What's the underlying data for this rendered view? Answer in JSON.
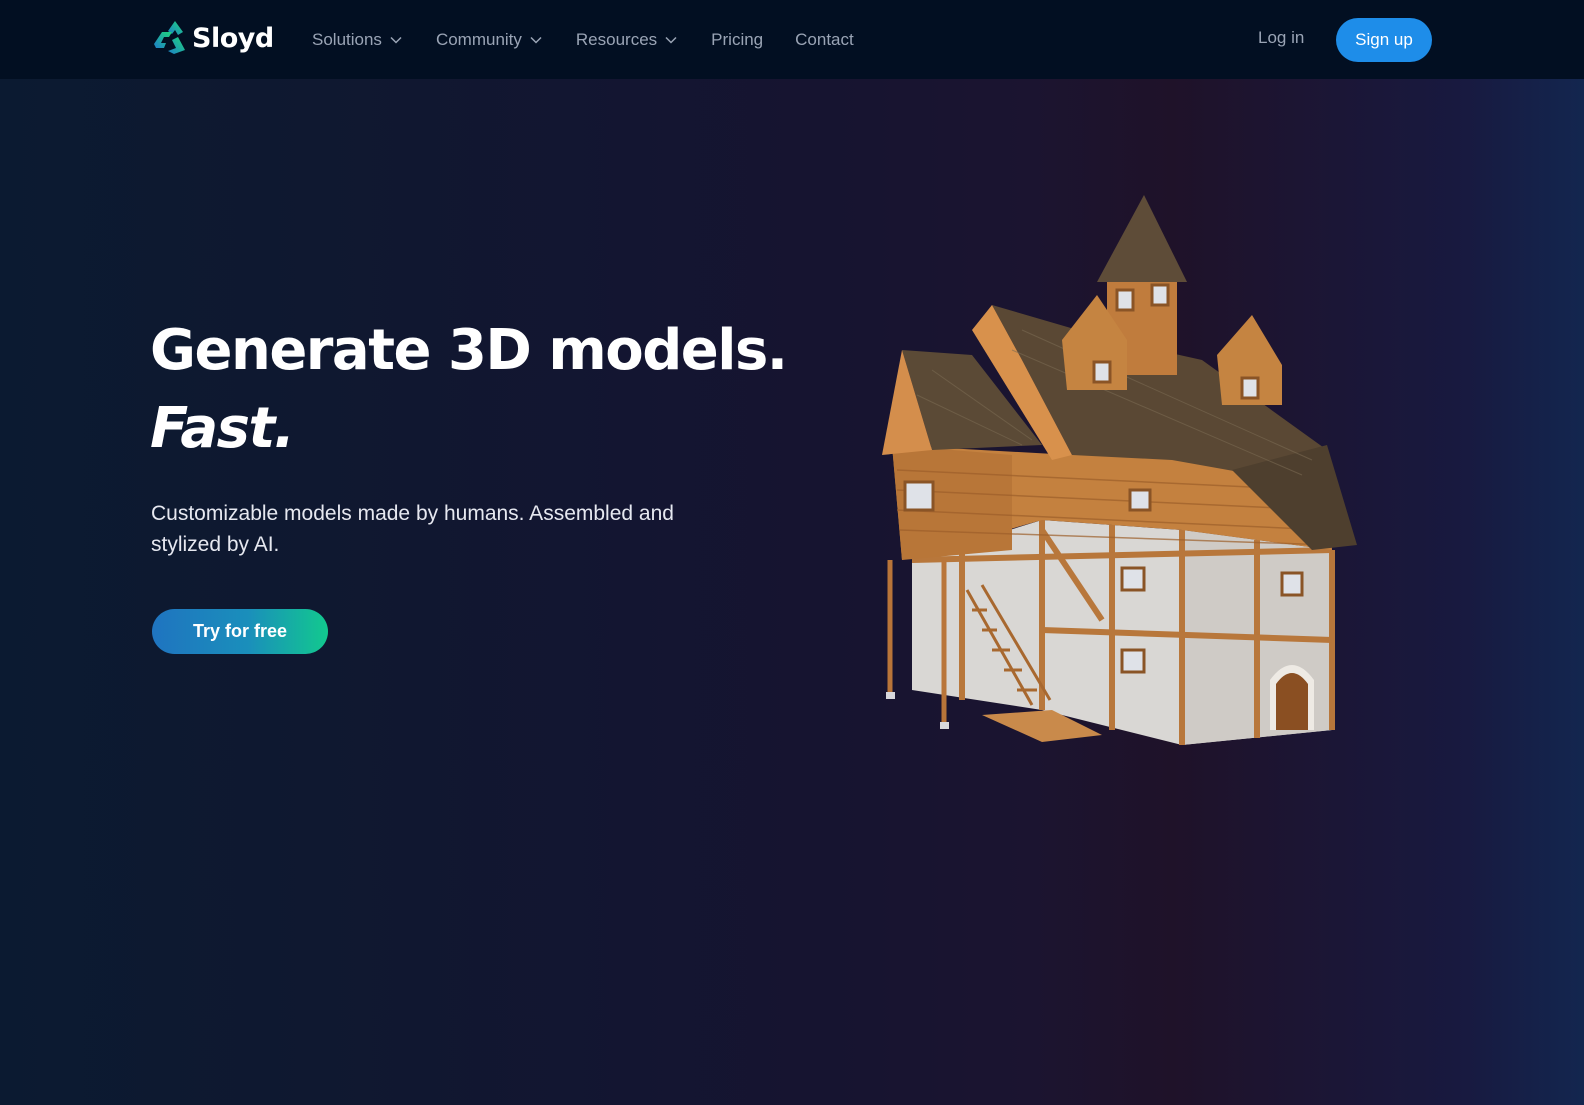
{
  "nav": {
    "brand": "Sloyd",
    "logo_icon": "sloyd-logo-icon",
    "items": [
      {
        "label": "Solutions",
        "has_dropdown": true
      },
      {
        "label": "Community",
        "has_dropdown": true
      },
      {
        "label": "Resources",
        "has_dropdown": true
      },
      {
        "label": "Pricing",
        "has_dropdown": false
      },
      {
        "label": "Contact",
        "has_dropdown": false
      }
    ],
    "login_label": "Log in",
    "signup_label": "Sign up"
  },
  "hero": {
    "title_line1": "Generate 3D models.",
    "title_line2": "Fast.",
    "subtitle": "Customizable models made by humans. Assembled and stylized by AI.",
    "cta_label": "Try for free",
    "image_alt": "3D model of a medieval timber house"
  },
  "colors": {
    "nav_bg": "#020f22",
    "signup_bg": "#1e8de9",
    "cta_gradient_start": "#1f74c0",
    "cta_gradient_end": "#12c98e",
    "nav_text": "#9aa4b5"
  }
}
